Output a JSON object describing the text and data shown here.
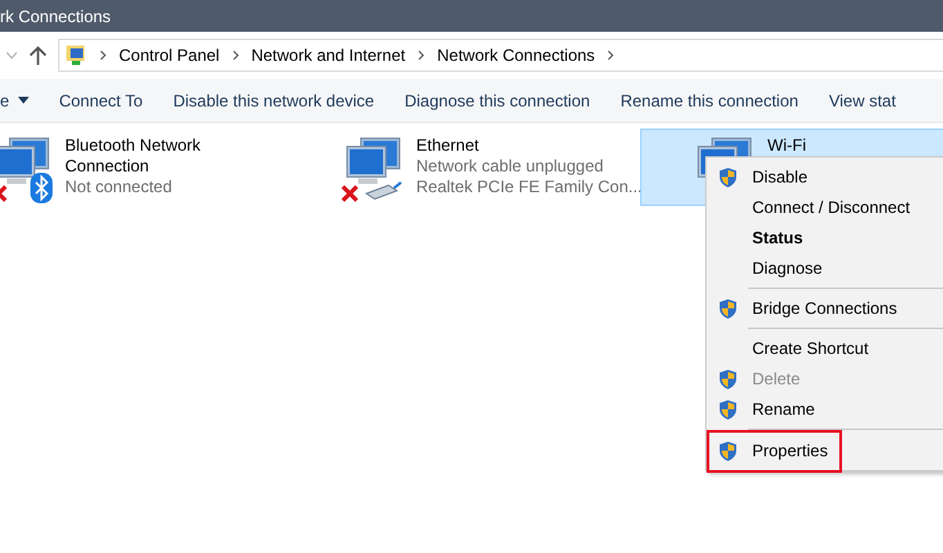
{
  "window": {
    "title": "rk Connections"
  },
  "address_bar": {
    "crumbs": [
      "Control Panel",
      "Network and Internet",
      "Network Connections"
    ]
  },
  "command_bar": {
    "items": [
      "e",
      "Connect To",
      "Disable this network device",
      "Diagnose this connection",
      "Rename this connection",
      "View stat"
    ]
  },
  "connections": [
    {
      "kind": "bluetooth",
      "name": "Bluetooth Network Connection",
      "status": "Not connected",
      "disconnected": true,
      "selected": false
    },
    {
      "kind": "ethernet",
      "name": "Ethernet",
      "status": "Network cable unplugged",
      "device": "Realtek PCIe FE Family Con...",
      "disconnected": true,
      "selected": false
    },
    {
      "kind": "wifi",
      "name": "Wi-Fi",
      "disconnected": false,
      "selected": true
    }
  ],
  "context_menu": {
    "items": [
      {
        "kind": "item",
        "label": "Disable",
        "shield": true,
        "bold": false,
        "disabled": false,
        "outlined": false
      },
      {
        "kind": "item",
        "label": "Connect / Disconnect",
        "shield": false,
        "bold": false,
        "disabled": false,
        "outlined": false
      },
      {
        "kind": "item",
        "label": "Status",
        "shield": false,
        "bold": true,
        "disabled": false,
        "outlined": false
      },
      {
        "kind": "item",
        "label": "Diagnose",
        "shield": false,
        "bold": false,
        "disabled": false,
        "outlined": false
      },
      {
        "kind": "separator"
      },
      {
        "kind": "item",
        "label": "Bridge Connections",
        "shield": true,
        "bold": false,
        "disabled": false,
        "outlined": false
      },
      {
        "kind": "separator"
      },
      {
        "kind": "item",
        "label": "Create Shortcut",
        "shield": false,
        "bold": false,
        "disabled": false,
        "outlined": false
      },
      {
        "kind": "item",
        "label": "Delete",
        "shield": true,
        "bold": false,
        "disabled": true,
        "outlined": false
      },
      {
        "kind": "item",
        "label": "Rename",
        "shield": true,
        "bold": false,
        "disabled": false,
        "outlined": false
      },
      {
        "kind": "separator"
      },
      {
        "kind": "item",
        "label": "Properties",
        "shield": true,
        "bold": false,
        "disabled": false,
        "outlined": true
      }
    ]
  }
}
